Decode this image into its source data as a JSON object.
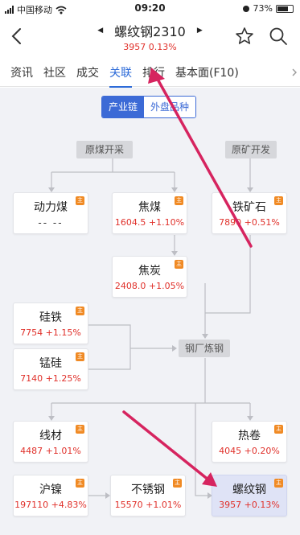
{
  "status_bar": {
    "carrier": "中国移动",
    "time": "09:20",
    "battery": "73%",
    "battery_level": 0.73
  },
  "header": {
    "title": "螺纹钢2310",
    "price_line": "3957 0.13%"
  },
  "tabs": [
    "资讯",
    "社区",
    "成交",
    "关联",
    "排行",
    "基本面(F10)"
  ],
  "active_tab": "关联",
  "segments": [
    "产业链",
    "外盘品种"
  ],
  "active_segment": "产业链",
  "groups": {
    "coal": "原煤开采",
    "ore": "原矿开发",
    "mill": "钢厂炼钢"
  },
  "badge_text": "主",
  "nodes": {
    "power_coal": {
      "name": "动力煤",
      "value": "-- --"
    },
    "coking_coal": {
      "name": "焦煤",
      "value": "1604.5 +1.10%"
    },
    "iron_ore": {
      "name": "铁矿石",
      "value": "7890 +0.51%"
    },
    "coke": {
      "name": "焦炭",
      "value": "2408.0 +1.05%"
    },
    "ferrosilicon": {
      "name": "硅铁",
      "value": "7754 +1.15%"
    },
    "silicomanganese": {
      "name": "锰硅",
      "value": "7140 +1.25%"
    },
    "wire_rod": {
      "name": "线材",
      "value": "4487 +1.01%"
    },
    "hot_coil": {
      "name": "热卷",
      "value": "4045 +0.20%"
    },
    "nickel": {
      "name": "沪镍",
      "value": "197110 +4.83%"
    },
    "stainless": {
      "name": "不锈钢",
      "value": "15570 +1.01%"
    },
    "rebar": {
      "name": "螺纹钢",
      "value": "3957 +0.13%"
    }
  },
  "colors": {
    "accent_blue": "#2d6bd8",
    "segment_blue": "#3c6ad6",
    "price_red": "#e0302a",
    "badge_orange": "#f08a24",
    "annotation_arrow": "#d6245f",
    "highlight_card": "#dfe3f6"
  },
  "icons": {
    "back": "back-chevron-icon",
    "prev": "prev-triangle-icon",
    "next": "next-triangle-icon",
    "star": "star-icon",
    "search": "search-icon"
  }
}
